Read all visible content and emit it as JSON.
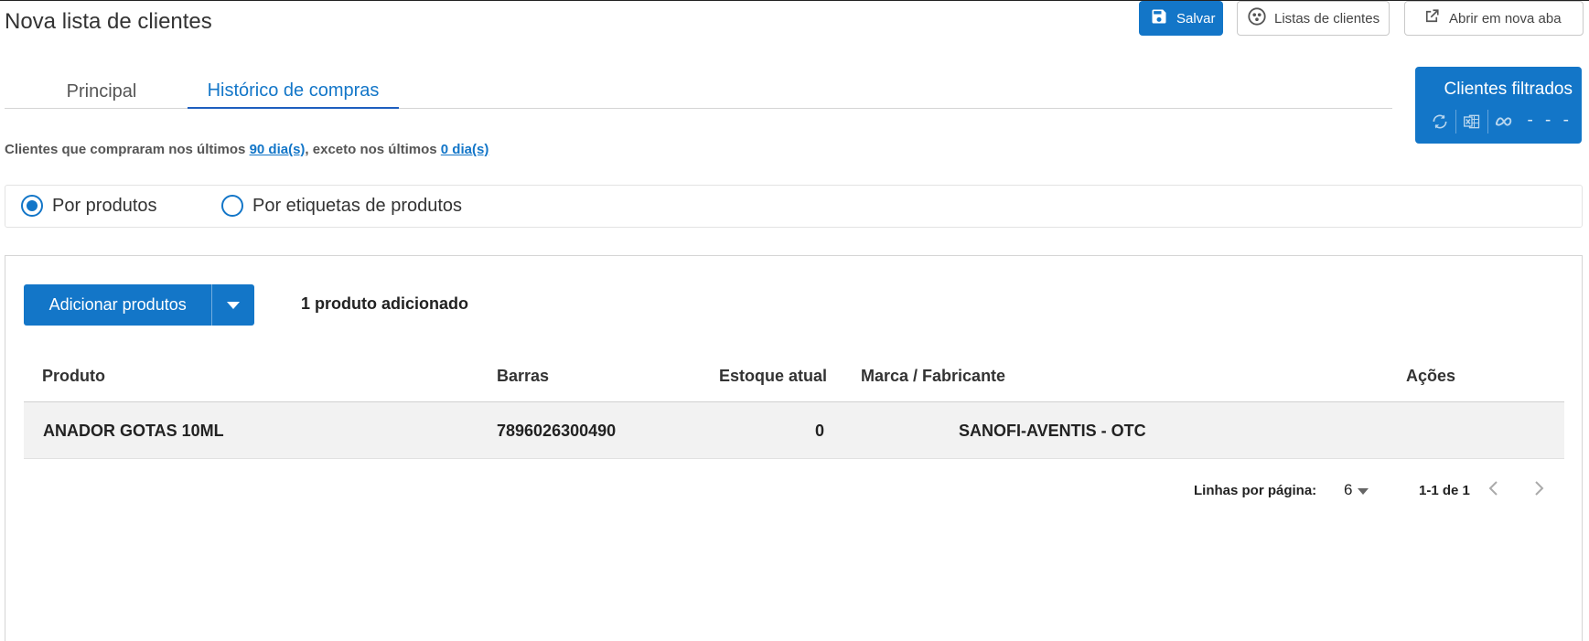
{
  "header": {
    "title": "Nova lista de clientes",
    "save_label": "Salvar",
    "lists_label": "Listas de clientes",
    "newtab_label": "Abrir em nova aba"
  },
  "tabs": [
    {
      "label": "Principal",
      "active": false
    },
    {
      "label": "Histórico de compras",
      "active": true
    }
  ],
  "filtered_panel": {
    "title": "Clientes filtrados",
    "count": "- - -",
    "icons": [
      "refresh-icon",
      "excel-icon",
      "meta-icon"
    ]
  },
  "info": {
    "prefix": "Clientes que compraram nos últimos ",
    "days_link": "90 dia(s)",
    "middle": ", exceto nos últimos ",
    "except_link": "0 dia(s)"
  },
  "filter_mode": {
    "options": [
      "Por produtos",
      "Por etiquetas de produtos"
    ],
    "selected": "Por produtos"
  },
  "products": {
    "add_label": "Adicionar produtos",
    "added_count": "1 produto adicionado",
    "columns": [
      "Produto",
      "Barras",
      "Estoque atual",
      "Marca / Fabricante",
      "Ações"
    ],
    "rows": [
      {
        "produto": "ANADOR GOTAS 10ML",
        "barras": "7896026300490",
        "estoque": "0",
        "marca": "SANOFI-AVENTIS - OTC",
        "acoes": ""
      }
    ]
  },
  "pagination": {
    "rows_label": "Linhas por página:",
    "rows_value": "6",
    "range": "1-1 de 1"
  },
  "colors": {
    "primary": "#1376c8",
    "tab_underline": "#1f5fbf"
  }
}
